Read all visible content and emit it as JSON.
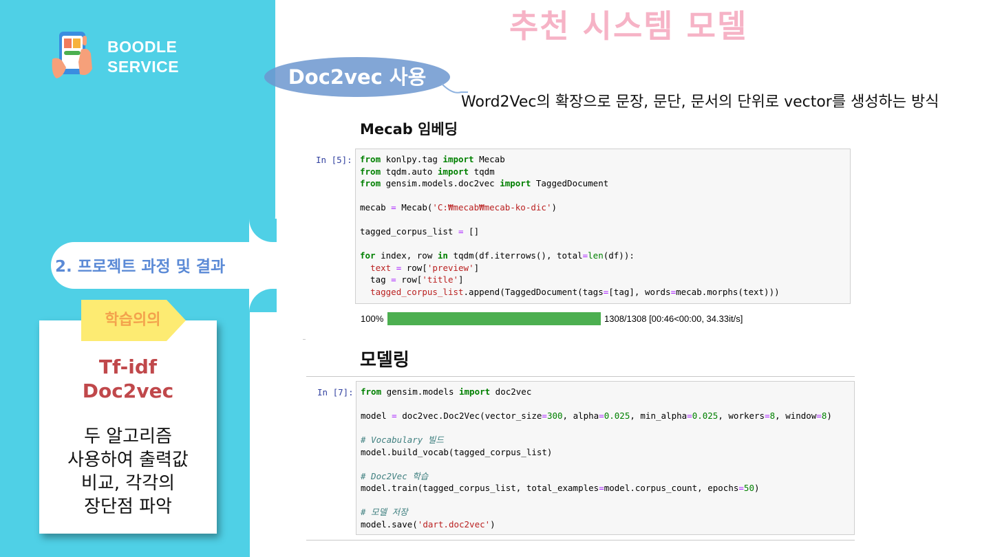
{
  "brand": {
    "line1": "BOODLE",
    "line2": "SERVICE"
  },
  "sidebar": {
    "section": "2. 프로젝트 과정 및 결과",
    "card": {
      "tag": "학습의의",
      "title_line1": "Tf-idf",
      "title_line2": "Doc2vec",
      "body_line1": "두 알고리즘",
      "body_line2": "사용하여 출력값",
      "body_line3": "비교, 각각의",
      "body_line4": "장단점 파악"
    }
  },
  "main": {
    "title": "추천 시스템 모델",
    "pill": "Doc2vec 사용",
    "subtitle": "Word2Vec의 확장으로 문장, 문단, 문서의 단위로 vector를 생성하는 방식",
    "heading1": "Mecab 임베딩",
    "heading2": "모델링",
    "cell1_prompt": "In [5]:",
    "cell2_prompt": "In [7]:",
    "progress": {
      "percent_label": "100%",
      "fraction": 1.0,
      "info": "1308/1308 [00:46<00:00, 34.33it/s]"
    }
  },
  "colors": {
    "sidebar": "#4fd0e6",
    "title": "#f6b3c6",
    "pill": "#6c97cf",
    "tag": "#fdeb72",
    "card_title": "#c0484b",
    "progress": "#4caf50"
  }
}
